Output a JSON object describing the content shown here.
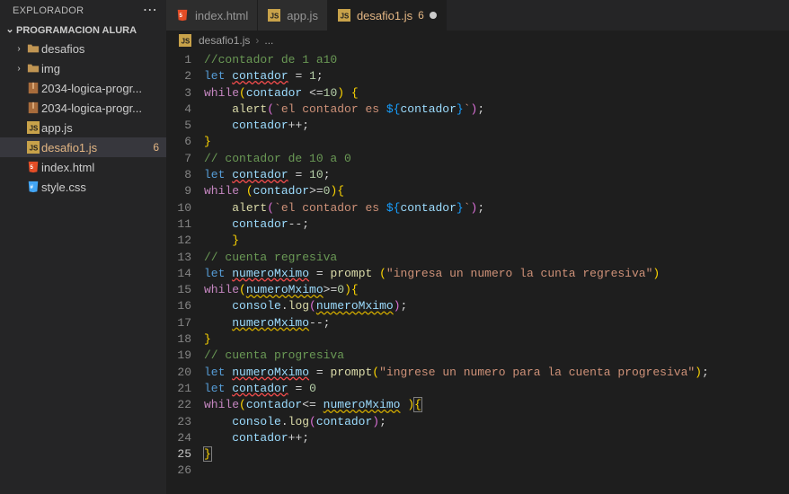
{
  "sidebar": {
    "title": "EXPLORADOR",
    "section": "PROGRAMACION ALURA",
    "items": [
      {
        "name": "desafios",
        "kind": "folder",
        "chev": "›"
      },
      {
        "name": "img",
        "kind": "folder",
        "chev": "›"
      },
      {
        "name": "2034-logica-progr...",
        "kind": "zip"
      },
      {
        "name": "2034-logica-progr...",
        "kind": "zip"
      },
      {
        "name": "app.js",
        "kind": "js"
      },
      {
        "name": "desafio1.js",
        "kind": "js",
        "selected": true,
        "badge": "6"
      },
      {
        "name": "index.html",
        "kind": "html"
      },
      {
        "name": "style.css",
        "kind": "css"
      }
    ]
  },
  "tabs": [
    {
      "label": "index.html",
      "kind": "html"
    },
    {
      "label": "app.js",
      "kind": "js"
    },
    {
      "label": "desafio1.js",
      "kind": "js",
      "active": true,
      "problems": "6",
      "dirty": true
    }
  ],
  "crumbs": {
    "file": "desafio1.js",
    "more": "..."
  },
  "code": {
    "lines": [
      "//contador de 1 a10",
      "let contador = 1;",
      "while(contador <=10) {",
      "    alert(`el contador es ${contador}`);",
      "    contador++;",
      "}",
      "// contador de 10 a 0",
      "let contador = 10;",
      "while (contador>=0){",
      "    alert(`el contador es ${contador}`);",
      "    contador--;",
      "    }",
      "// cuenta regresiva",
      "let numeroMximo = prompt (\"ingresa un numero la cunta regresiva\")",
      "while(numeroMximo>=0){",
      "    console.log(numeroMximo);",
      "    numeroMximo--;",
      "}",
      "// cuenta progresiva",
      "let numeroMximo = prompt(\"ingrese un numero para la cuenta progresiva\");",
      "let contador = 0",
      "while(contador<= numeroMximo ){",
      "    console.log(contador);",
      "    contador++;",
      "}",
      ""
    ],
    "current_line": 25
  }
}
